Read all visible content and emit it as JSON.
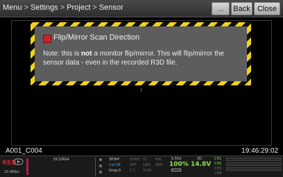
{
  "topbar": {
    "breadcrumb": [
      "Menu",
      "Settings",
      "Project",
      "Sensor"
    ],
    "separator": ">",
    "more_label": "...",
    "back_label": "Back",
    "close_label": "Close"
  },
  "dialog": {
    "title": "Flip/Mirror Scan Direction",
    "body_prefix": "Note: this is ",
    "body_emphasis": "not",
    "body_suffix": " a monitor flip/mirror.  This will flip/mirror the sensor data - even in the recorded R3D file."
  },
  "clip_name": "A001_C004",
  "timecode": "19:46:29:02",
  "status": {
    "fps": "23.98fps",
    "codec": "DC2/RG4",
    "iso_lines": [
      "3P/64\"",
      "Cal:OE",
      "Drop:0"
    ],
    "col2": [
      "HDRX",
      "OFF",
      "1:1"
    ],
    "col3": [
      "TC",
      "GEN",
      "SYNC"
    ],
    "col4": [
      "RIG",
      "WIFI",
      ""
    ],
    "battery_label": "S-550",
    "battery_percent": "100%",
    "dc_label": "DC",
    "dc_voltage": "14.8V",
    "channels": [
      "CH1",
      "CH2",
      "CH3",
      "CH4"
    ]
  },
  "colors": {
    "hazard_yellow": "#f0d21c",
    "dialog_bg": "#5d5d5d",
    "status_green": "#8ce14f",
    "accent_red": "#c8212a"
  }
}
